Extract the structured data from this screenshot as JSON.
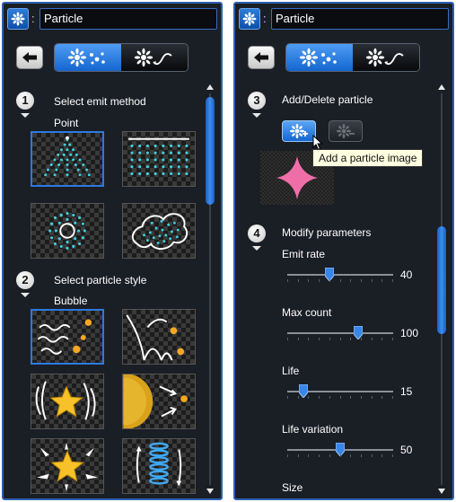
{
  "left_panel": {
    "title": "Particle",
    "sections": [
      {
        "number": "1",
        "title": "Select emit method",
        "selected": "Point"
      },
      {
        "number": "2",
        "title": "Select particle style",
        "selected": "Bubble"
      }
    ]
  },
  "right_panel": {
    "title": "Particle",
    "add_delete": {
      "number": "3",
      "title": "Add/Delete particle",
      "tooltip": "Add a particle image"
    },
    "modify": {
      "number": "4",
      "title": "Modify parameters",
      "params": [
        {
          "label": "Emit rate",
          "value": "40",
          "level": 0.4
        },
        {
          "label": "Max count",
          "value": "100",
          "level": 0.67
        },
        {
          "label": "Life",
          "value": "15",
          "level": 0.15
        },
        {
          "label": "Life variation",
          "value": "50",
          "level": 0.5
        },
        {
          "label": "Size",
          "value": "",
          "level": null
        }
      ]
    }
  },
  "colors": {
    "accent": "#2f5fb0",
    "active_button": "#1466d0",
    "panel_bg": "#1a1e25",
    "particle_cyan": "#3fd0e0",
    "sparkle_pink": "#ee6fa8"
  },
  "icons": [
    "flower-icon",
    "back-arrow-icon",
    "particles-mode-icon",
    "path-mode-icon",
    "add-particle-icon",
    "delete-particle-icon",
    "mouse-cursor-icon"
  ]
}
